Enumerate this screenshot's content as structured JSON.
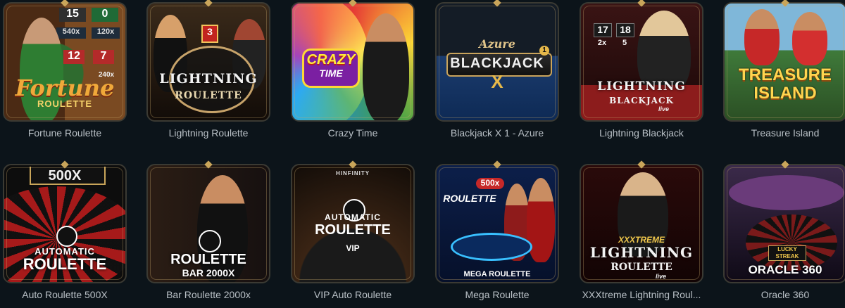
{
  "games": [
    {
      "name": "Fortune Roulette",
      "logo_main": "Fortune",
      "logo_sub": "ROULETTE",
      "tiles": [
        "15",
        "0",
        "540x",
        "120x",
        "12",
        "7",
        "240x"
      ]
    },
    {
      "name": "Lightning Roulette",
      "logo_main": "LIGHTNING",
      "logo_sub": "ROULETTE",
      "badge": "3"
    },
    {
      "name": "Crazy Time",
      "logo_main": "CRAZY",
      "logo_sub": "TIME"
    },
    {
      "name": "Blackjack X 1 - Azure",
      "logo_top": "Azure",
      "logo_main": "BLACKJACK",
      "logo_sub": "X",
      "badge": "1"
    },
    {
      "name": "Lightning Blackjack",
      "tiles": [
        "17",
        "18",
        "2x",
        "5"
      ],
      "logo_main": "LIGHTNING",
      "logo_sub": "BLACKJACK",
      "logo_tag": "live"
    },
    {
      "name": "Treasure Island",
      "logo_main": "TREASURE",
      "logo_sub": "ISLAND"
    },
    {
      "name": "Auto Roulette 500X",
      "logo_top": "500X",
      "logo_main": "AUTOMATIC",
      "logo_sub": "ROULETTE"
    },
    {
      "name": "Bar Roulette 2000x",
      "logo_main": "ROULETTE",
      "logo_sub": "BAR 2000X"
    },
    {
      "name": "VIP Auto Roulette",
      "logo_top": "HINFINITY",
      "logo_main": "AUTOMATIC",
      "logo_sub": "ROULETTE",
      "logo_tag": "VIP"
    },
    {
      "name": "Mega Roulette",
      "logo_top": "500x",
      "logo_main": "ROULETTE",
      "logo_sub": "MEGA ROULETTE"
    },
    {
      "name": "XXXtreme Lightning Roul...",
      "logo_top": "XXXTREME",
      "logo_main": "LIGHTNING",
      "logo_sub": "ROULETTE",
      "logo_tag": "live"
    },
    {
      "name": "Oracle 360",
      "logo_top": "LUCKY STREAK",
      "logo_main": "ORACLE 360"
    }
  ]
}
